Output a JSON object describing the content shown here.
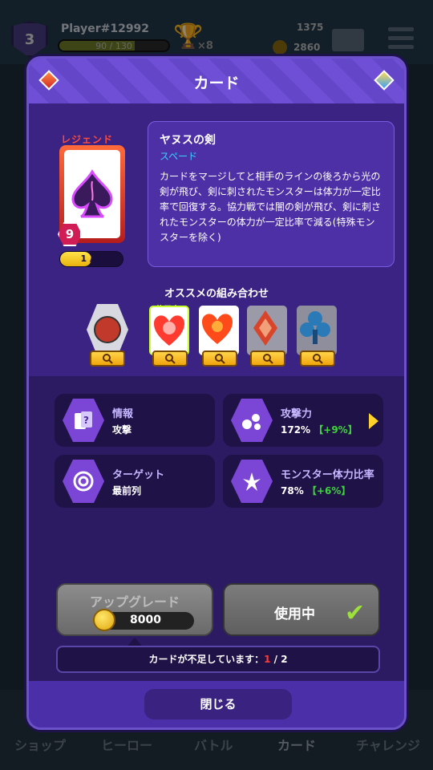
{
  "hud": {
    "level": "3",
    "player_name": "Player#12992",
    "xp_text": "90 / 130",
    "xp_progress": 0.69,
    "trophy_count": "×8",
    "resource_top": "1375",
    "resource_coin": "2860"
  },
  "nav": [
    "ショップ",
    "ヒーロー",
    "バトル",
    "カード",
    "チャレンジ"
  ],
  "modal": {
    "title": "カード",
    "rarity": "レジェンド",
    "card_level": "9",
    "card_progress": "1 / 2",
    "card_progress_value": 0.5,
    "card_name": "ヤヌスの剣",
    "card_suit": "スペード",
    "description": "カードをマージしてと相手のラインの後ろから光の剣が飛び、剣に刺されたモンスターは体力が一定比率で回復する。協力戦では闇の剣が飛び、剣に刺されたモンスターの体力が一定比率で減る(特殊モンスターを除く)",
    "recommend_title": "オススメの組み合わせ",
    "using_tag": "使用中",
    "stats": [
      {
        "label": "情報",
        "value": "攻撃",
        "bonus": ""
      },
      {
        "label": "攻撃力",
        "value": "172%",
        "bonus": "【+9%】"
      },
      {
        "label": "ターゲット",
        "value": "最前列",
        "bonus": ""
      },
      {
        "label": "モンスター体力比率",
        "value": "78%",
        "bonus": "【+6%】"
      }
    ],
    "upgrade_label": "アップグレード",
    "upgrade_price": "8000",
    "using_label": "使用中",
    "notice_prefix": "カードが不足しています：",
    "notice_have": "1",
    "notice_rest": " / 2",
    "close_label": "閉じる"
  },
  "colors": {
    "modal_bg": "#3a2380",
    "accent_yellow": "#ffd54a",
    "bonus_green": "#3dd43a",
    "suit_cyan": "#3ad1ff",
    "rarity_red": "#ff4b3b"
  }
}
